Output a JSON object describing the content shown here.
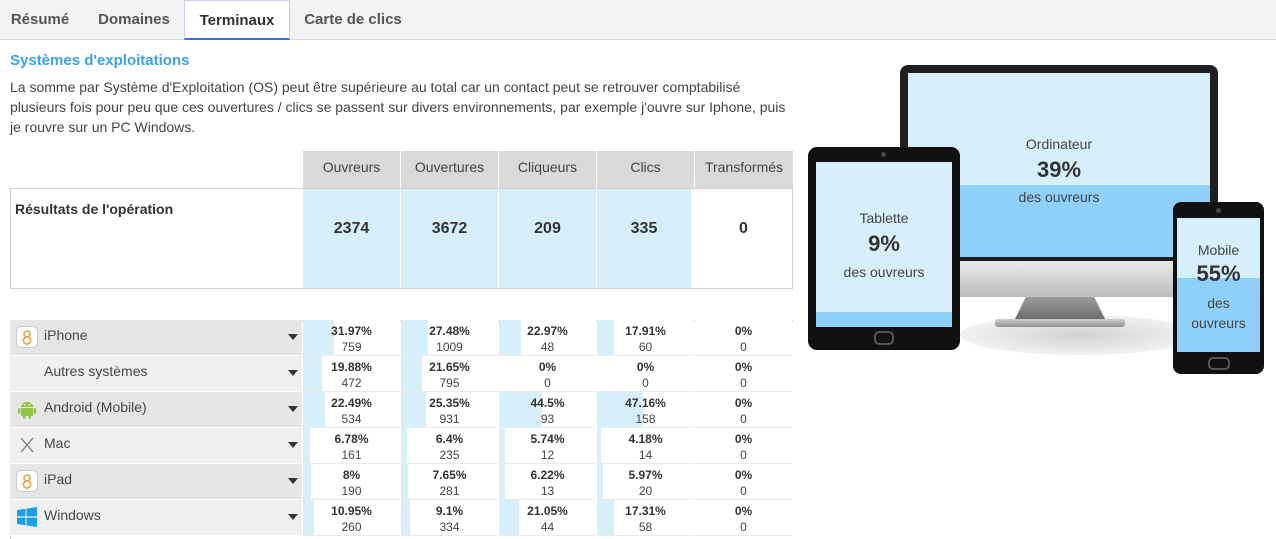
{
  "tabs": [
    {
      "label": "Résumé",
      "active": false
    },
    {
      "label": "Domaines",
      "active": false
    },
    {
      "label": "Terminaux",
      "active": true
    },
    {
      "label": "Carte de clics",
      "active": false
    }
  ],
  "section": {
    "title": "Systèmes d'exploitations",
    "description": "La somme par Système d'Exploitation (OS) peut être supérieure au total car un contact peut se retrouver comptabilisé plusieurs fois pour peu que ces ouvertures / clics se passent sur divers environnements, par exemple j'ouvre sur Iphone, puis je rouvre sur un PC Windows."
  },
  "columns": [
    "Ouvreurs",
    "Ouvertures",
    "Cliqueurs",
    "Clics",
    "Transformés"
  ],
  "results": {
    "label": "Résultats de l'opération",
    "values": [
      "2374",
      "3672",
      "209",
      "335",
      "0"
    ]
  },
  "os_rows": [
    {
      "name": "iPhone",
      "icon": "ios-icon",
      "cells": [
        {
          "pct": "31.97%",
          "count": "759"
        },
        {
          "pct": "27.48%",
          "count": "1009"
        },
        {
          "pct": "22.97%",
          "count": "48"
        },
        {
          "pct": "17.91%",
          "count": "60"
        },
        {
          "pct": "0%",
          "count": "0"
        }
      ]
    },
    {
      "name": "Autres systèmes",
      "icon": "",
      "cells": [
        {
          "pct": "19.88%",
          "count": "472"
        },
        {
          "pct": "21.65%",
          "count": "795"
        },
        {
          "pct": "0%",
          "count": "0"
        },
        {
          "pct": "0%",
          "count": "0"
        },
        {
          "pct": "0%",
          "count": "0"
        }
      ]
    },
    {
      "name": "Android (Mobile)",
      "icon": "android-icon",
      "cells": [
        {
          "pct": "22.49%",
          "count": "534"
        },
        {
          "pct": "25.35%",
          "count": "931"
        },
        {
          "pct": "44.5%",
          "count": "93"
        },
        {
          "pct": "47.16%",
          "count": "158"
        },
        {
          "pct": "0%",
          "count": "0"
        }
      ]
    },
    {
      "name": "Mac",
      "icon": "mac-icon",
      "cells": [
        {
          "pct": "6.78%",
          "count": "161"
        },
        {
          "pct": "6.4%",
          "count": "235"
        },
        {
          "pct": "5.74%",
          "count": "12"
        },
        {
          "pct": "4.18%",
          "count": "14"
        },
        {
          "pct": "0%",
          "count": "0"
        }
      ]
    },
    {
      "name": "iPad",
      "icon": "ios-icon",
      "cells": [
        {
          "pct": "8%",
          "count": "190"
        },
        {
          "pct": "7.65%",
          "count": "281"
        },
        {
          "pct": "6.22%",
          "count": "13"
        },
        {
          "pct": "5.97%",
          "count": "20"
        },
        {
          "pct": "0%",
          "count": "0"
        }
      ]
    },
    {
      "name": "Windows",
      "icon": "windows-icon",
      "cells": [
        {
          "pct": "10.95%",
          "count": "260"
        },
        {
          "pct": "9.1%",
          "count": "334"
        },
        {
          "pct": "21.05%",
          "count": "44"
        },
        {
          "pct": "17.31%",
          "count": "58"
        },
        {
          "pct": "0%",
          "count": "0"
        }
      ]
    }
  ],
  "devices": {
    "desktop": {
      "name": "Ordinateur",
      "pct": "39%",
      "sub": "des ouvreurs",
      "fraction": 0.39
    },
    "tablet": {
      "name": "Tablette",
      "pct": "9%",
      "sub": "des ouvreurs",
      "fraction": 0.09
    },
    "mobile": {
      "name": "Mobile",
      "pct": "55%",
      "sub_line1": "des",
      "sub_line2": "ouvreurs",
      "fraction": 0.55
    }
  },
  "colors": {
    "accent": "#3aa0e8",
    "bar": "#d7eefb",
    "device_fill": "#8ed0fa"
  }
}
